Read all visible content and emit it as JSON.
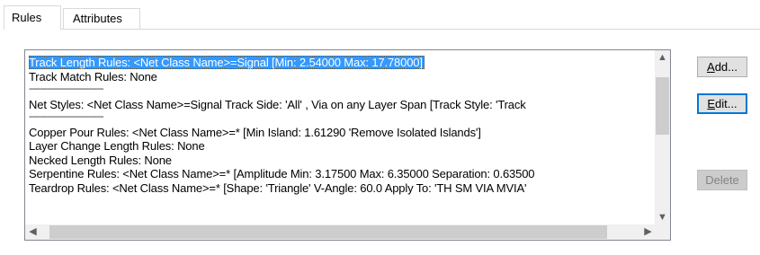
{
  "tabs": [
    {
      "label": "Rules",
      "active": true
    },
    {
      "label": "Attributes",
      "active": false
    }
  ],
  "rules_list": {
    "lines": [
      "Track Length Rules: <Net Class Name>=Signal  [Min: 2.54000  Max: 17.78000]",
      "Track Match Rules: None",
      "-------------------------------",
      "Net Styles: <Net Class Name>=Signal  Track Side: 'All' , Via on any Layer Span  [Track Style: 'Track",
      "-------------------------------",
      "Copper Pour Rules: <Net Class Name>=*  [Min Island: 1.61290 'Remove Isolated Islands']",
      "Layer Change Length Rules: None",
      "Necked Length Rules: None",
      "Serpentine Rules: <Net Class Name>=*  [Amplitude Min: 3.17500 Max: 6.35000 Separation: 0.63500",
      "Teardrop Rules: <Net Class Name>=*  [Shape: 'Triangle' V-Angle: 60.0 Apply To: 'TH SM VIA MVIA'"
    ],
    "selected_index": 0
  },
  "buttons": {
    "add": {
      "pre": "",
      "accel": "A",
      "post": "dd..."
    },
    "edit": {
      "pre": "",
      "accel": "E",
      "post": "dit..."
    },
    "delete": "Delete"
  },
  "icons": {
    "scroll_up": "▲",
    "scroll_down": "▼",
    "scroll_left": "◀",
    "scroll_right": "▶"
  }
}
